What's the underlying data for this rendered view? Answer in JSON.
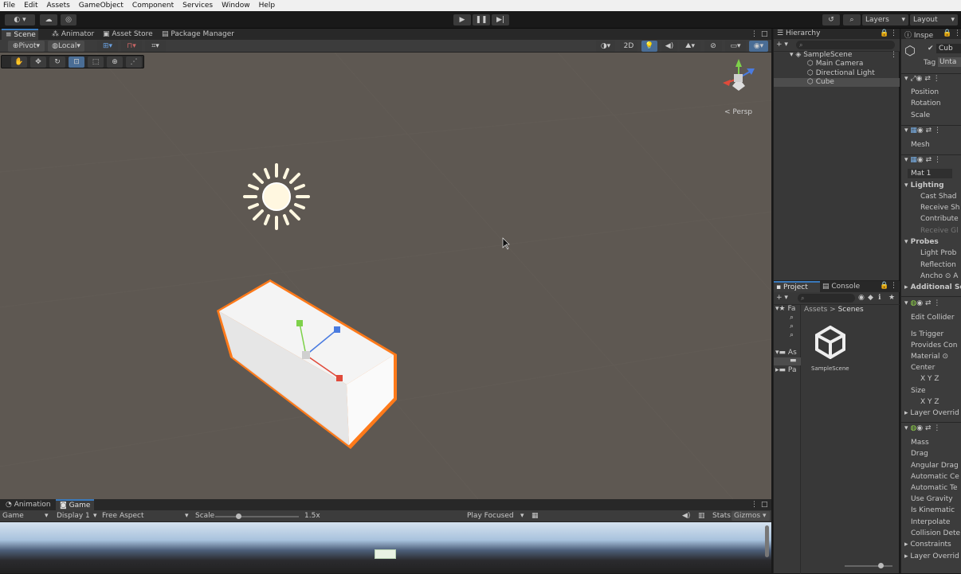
{
  "menu": [
    "File",
    "Edit",
    "Assets",
    "GameObject",
    "Component",
    "Services",
    "Window",
    "Help"
  ],
  "toolbar": {
    "layers": "Layers",
    "layout": "Layout"
  },
  "scene_tabs": [
    "Scene",
    "Animator",
    "Asset Store",
    "Package Manager"
  ],
  "scene_tools": {
    "pivot": "Pivot",
    "local": "Local",
    "mode_2d": "2D"
  },
  "gizmo": {
    "persp": "< Persp"
  },
  "game_tabs": [
    "Animation",
    "Game"
  ],
  "game_bar": {
    "display_mode": "Game",
    "display": "Display 1",
    "aspect": "Free Aspect",
    "scale_label": "Scale",
    "scale_value": "1.5x",
    "play_mode": "Play Focused",
    "stats": "Stats",
    "gizmos": "Gizmos"
  },
  "hierarchy": {
    "title": "Hierarchy",
    "scene": "SampleScene",
    "items": [
      "Main Camera",
      "Directional Light",
      "Cube"
    ]
  },
  "project": {
    "tabs": [
      "Project",
      "Console"
    ],
    "breadcrumb_root": "Assets",
    "breadcrumb_sep": ">",
    "breadcrumb_current": "Scenes",
    "favorites": "Fa",
    "assets_folder": "As",
    "packages_folder": "Pa",
    "asset_name": "SampleScene"
  },
  "inspector": {
    "title": "Inspe",
    "object_name": "Cub",
    "tag_label": "Tag",
    "tag_value": "Unta",
    "transform": [
      "Position",
      "Rotation",
      "Scale"
    ],
    "mesh_filter": [
      "Mesh"
    ],
    "material": "Mat 1",
    "lighting_header": "Lighting",
    "lighting": [
      "Cast Shad",
      "Receive Sh",
      "Contribute",
      "Receive Gl"
    ],
    "probes_header": "Probes",
    "probes": [
      "Light Prob",
      "Reflection",
      "Ancho ⊙ A"
    ],
    "additional": "Additional Se",
    "box_collider": [
      "Edit Collider",
      "Is Trigger",
      "Provides Con",
      "Material",
      "Center",
      "X  Y  Z",
      "Size",
      "X  Y  Z"
    ],
    "layer_overrides": "Layer Overrid",
    "rigidbody": [
      "Mass",
      "Drag",
      "Angular Drag",
      "Automatic Ce",
      "Automatic Te",
      "Use Gravity",
      "Is Kinematic",
      "Interpolate",
      "Collision Dete"
    ],
    "constraints": "Constraints",
    "layer_overrides2": "Layer Overrid"
  },
  "colors": {
    "accent": "#3a79bb",
    "scene_bg": "#5e5852",
    "selection_outline": "#ff7a1a"
  }
}
